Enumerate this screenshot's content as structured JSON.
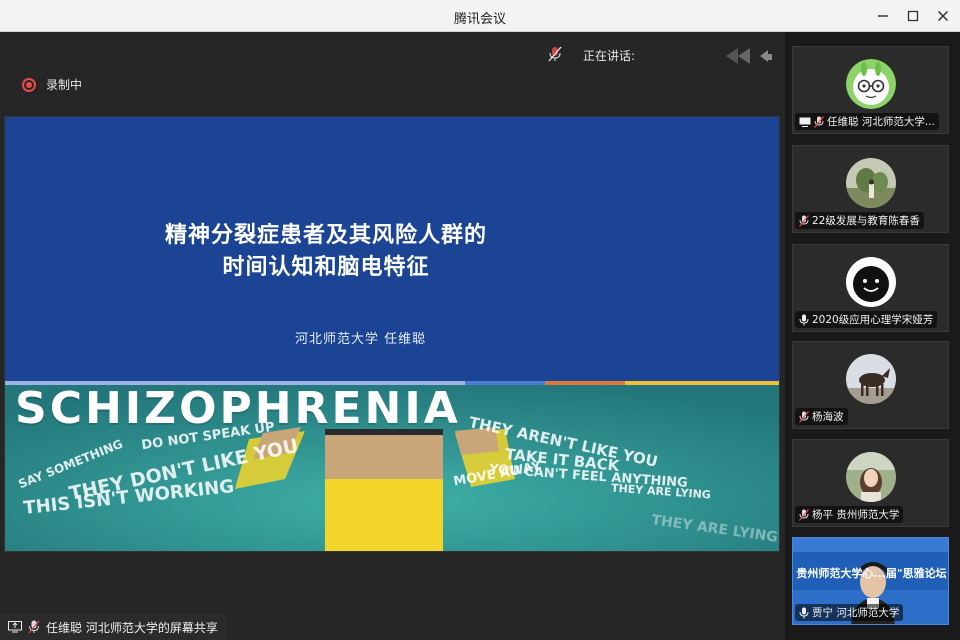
{
  "window": {
    "title": "腾讯会议"
  },
  "stage": {
    "speaking_label": "正在讲话:",
    "recording_label": "录制中"
  },
  "slide": {
    "title_line1": "精神分裂症患者及其风险人群的",
    "title_line2": "时间认知和脑电特征",
    "author": "河北师范大学  任维聪",
    "banner_word": "SCHIZOPHRENIA",
    "phrases": [
      "SAY SOMETHING",
      "DO NOT SPEAK UP",
      "THEY DON'T LIKE YOU",
      "THIS ISN'T WORKING",
      "THEY AREN'T LIKE YOU",
      "TAKE IT BACK",
      "YOU CAN'T FEEL ANYTHING",
      "MOVE AWAY",
      "THEY ARE LYING",
      "THEY ARE LYING"
    ]
  },
  "share_label": "任维聪 河北师范大学的屏幕共享",
  "participants": [
    {
      "name": "任维聪 河北师范大学...",
      "screen_share": true,
      "mic": "muted"
    },
    {
      "name": "22级发展与教育陈春香",
      "screen_share": false,
      "mic": "muted"
    },
    {
      "name": "2020级应用心理学宋娅芳",
      "screen_share": false,
      "mic": "on"
    },
    {
      "name": "杨海波",
      "screen_share": false,
      "mic": "muted"
    },
    {
      "name": "杨平 贵州师范大学",
      "screen_share": false,
      "mic": "muted"
    },
    {
      "name": "贾宁 河北师范大学",
      "screen_share": false,
      "mic": "on",
      "video_caption": "贵州师范大学心...届\"思雅论坛"
    }
  ],
  "colors": {
    "recording": "#e84a4a",
    "slide_bg": "#1b4494",
    "banner_bg": "#2a8f8f"
  }
}
